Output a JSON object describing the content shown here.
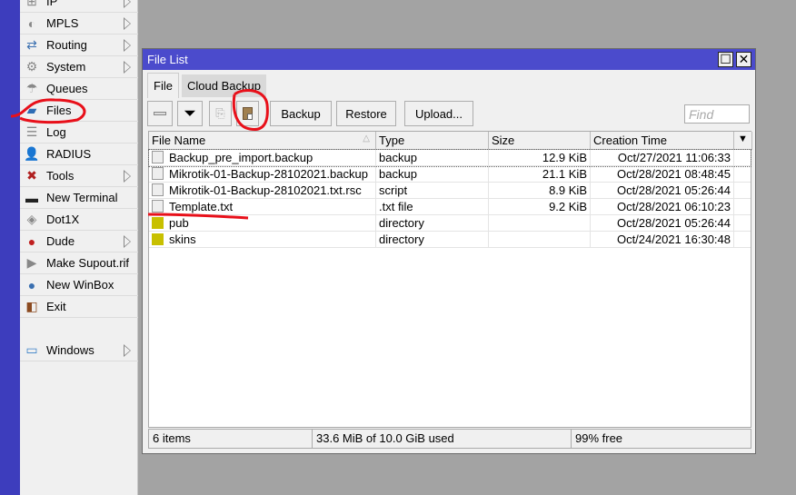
{
  "sidebar": {
    "items": [
      {
        "label": "IP",
        "icon": "ip-icon",
        "submenu": true
      },
      {
        "label": "MPLS",
        "icon": "mpls-icon",
        "submenu": true
      },
      {
        "label": "Routing",
        "icon": "routing-icon",
        "submenu": true
      },
      {
        "label": "System",
        "icon": "gear-icon",
        "submenu": true
      },
      {
        "label": "Queues",
        "icon": "queues-icon",
        "submenu": false
      },
      {
        "label": "Files",
        "icon": "folder-icon",
        "submenu": false
      },
      {
        "label": "Log",
        "icon": "log-icon",
        "submenu": false
      },
      {
        "label": "RADIUS",
        "icon": "radius-icon",
        "submenu": false
      },
      {
        "label": "Tools",
        "icon": "tools-icon",
        "submenu": true
      },
      {
        "label": "New Terminal",
        "icon": "terminal-icon",
        "submenu": false
      },
      {
        "label": "Dot1X",
        "icon": "dot1x-icon",
        "submenu": false
      },
      {
        "label": "Dude",
        "icon": "dude-icon",
        "submenu": true
      },
      {
        "label": "Make Supout.rif",
        "icon": "supout-icon",
        "submenu": false
      },
      {
        "label": "New WinBox",
        "icon": "winbox-icon",
        "submenu": false
      },
      {
        "label": "Exit",
        "icon": "exit-icon",
        "submenu": false
      },
      {
        "label": "Windows",
        "icon": "windows-icon",
        "submenu": true
      }
    ]
  },
  "window": {
    "title": "File List",
    "tabs": [
      "File",
      "Cloud Backup"
    ],
    "toolbar": {
      "backup": "Backup",
      "restore": "Restore",
      "upload": "Upload...",
      "find_placeholder": "Find"
    },
    "columns": [
      "File Name",
      "Type",
      "Size",
      "Creation Time"
    ],
    "rows": [
      {
        "name": "Backup_pre_import.backup",
        "type": "backup",
        "size": "12.9 KiB",
        "time": "Oct/27/2021 11:06:33",
        "kind": "file"
      },
      {
        "name": "Mikrotik-01-Backup-28102021.backup",
        "type": "backup",
        "size": "21.1 KiB",
        "time": "Oct/28/2021 08:48:45",
        "kind": "file"
      },
      {
        "name": "Mikrotik-01-Backup-28102021.txt.rsc",
        "type": "script",
        "size": "8.9 KiB",
        "time": "Oct/28/2021 05:26:44",
        "kind": "file"
      },
      {
        "name": "Template.txt",
        "type": ".txt file",
        "size": "9.2 KiB",
        "time": "Oct/28/2021 06:10:23",
        "kind": "file"
      },
      {
        "name": "pub",
        "type": "directory",
        "size": "",
        "time": "Oct/28/2021 05:26:44",
        "kind": "dir"
      },
      {
        "name": "skins",
        "type": "directory",
        "size": "",
        "time": "Oct/24/2021 16:30:48",
        "kind": "dir"
      }
    ],
    "status": {
      "items": "6 items",
      "used": "33.6 MiB of 10.0 GiB used",
      "free": "99% free"
    }
  },
  "colors": {
    "title_bar": "#4b4bcc",
    "sidebar_strip": "#3d3dbd",
    "annotation": "#e8101a"
  }
}
